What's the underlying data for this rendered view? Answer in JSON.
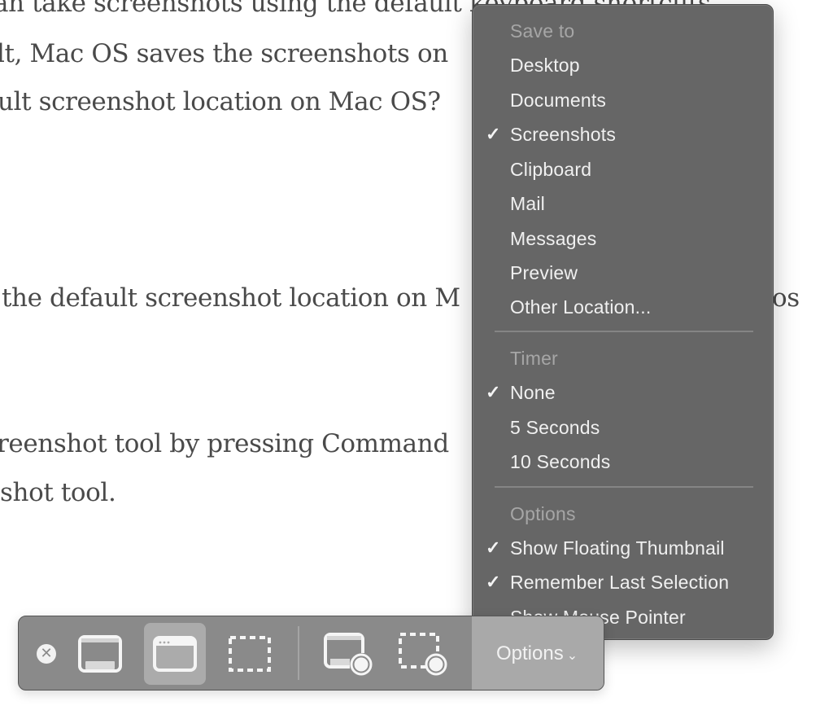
{
  "article": {
    "lines": [
      "an take screenshots using the default keyboard shortcuts",
      "lt, Mac OS saves the screenshots on",
      "ult screenshot location on Mac OS?",
      "the default screenshot location on M",
      "os",
      "reenshot tool by pressing Command",
      "shot tool."
    ]
  },
  "menu": {
    "sections": [
      {
        "header": "Save to",
        "items": [
          {
            "label": "Desktop",
            "checked": false
          },
          {
            "label": "Documents",
            "checked": false
          },
          {
            "label": "Screenshots",
            "checked": true
          },
          {
            "label": "Clipboard",
            "checked": false
          },
          {
            "label": "Mail",
            "checked": false
          },
          {
            "label": "Messages",
            "checked": false
          },
          {
            "label": "Preview",
            "checked": false
          },
          {
            "label": "Other Location...",
            "checked": false
          }
        ]
      },
      {
        "header": "Timer",
        "items": [
          {
            "label": "None",
            "checked": true
          },
          {
            "label": "5 Seconds",
            "checked": false
          },
          {
            "label": "10 Seconds",
            "checked": false
          }
        ]
      },
      {
        "header": "Options",
        "items": [
          {
            "label": "Show Floating Thumbnail",
            "checked": true
          },
          {
            "label": "Remember Last Selection",
            "checked": true
          },
          {
            "label": "Show Mouse Pointer",
            "checked": false
          }
        ]
      }
    ],
    "check_glyph": "✓"
  },
  "toolbar": {
    "close_glyph": "✕",
    "buttons": [
      {
        "name": "capture-entire-screen",
        "icon": "screen-icon",
        "selected": false
      },
      {
        "name": "capture-selected-window",
        "icon": "window-icon",
        "selected": true
      },
      {
        "name": "capture-selected-portion",
        "icon": "dashed-selection-icon",
        "selected": false
      },
      {
        "name": "record-entire-screen",
        "icon": "screen-record-icon",
        "selected": false
      },
      {
        "name": "record-selected-portion",
        "icon": "selection-record-icon",
        "selected": false
      }
    ],
    "options_label": "Options",
    "options_chevron": "⌄"
  }
}
